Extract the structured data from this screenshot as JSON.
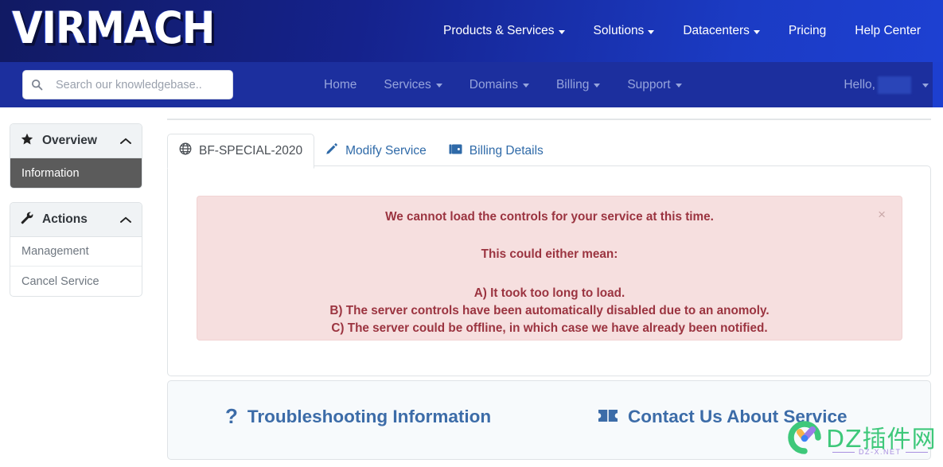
{
  "header": {
    "logo": "VIRMACH",
    "nav": [
      {
        "label": "Products & Services",
        "has_caret": true
      },
      {
        "label": "Solutions",
        "has_caret": true
      },
      {
        "label": "Datacenters",
        "has_caret": true
      },
      {
        "label": "Pricing",
        "has_caret": false
      },
      {
        "label": "Help Center",
        "has_caret": false
      }
    ]
  },
  "subnav": {
    "search": {
      "placeholder": "Search our knowledgebase..",
      "value": "",
      "icon": "search-icon"
    },
    "items": [
      {
        "label": "Home",
        "has_caret": false
      },
      {
        "label": "Services",
        "has_caret": true
      },
      {
        "label": "Domains",
        "has_caret": true
      },
      {
        "label": "Billing",
        "has_caret": true
      },
      {
        "label": "Support",
        "has_caret": true
      }
    ],
    "account": {
      "greeting": "Hello,",
      "username_redacted": true
    }
  },
  "sidebar": {
    "panels": [
      {
        "title": "Overview",
        "icon": "star-icon",
        "collapse_icon": "chevron-up-icon",
        "items": [
          {
            "label": "Information",
            "active": true
          }
        ]
      },
      {
        "title": "Actions",
        "icon": "wrench-icon",
        "collapse_icon": "chevron-up-icon",
        "items": [
          {
            "label": "Management",
            "active": false
          },
          {
            "label": "Cancel Service",
            "active": false
          }
        ]
      }
    ]
  },
  "tabs": [
    {
      "label": "BF-SPECIAL-2020",
      "icon": "globe-icon",
      "active": true
    },
    {
      "label": "Modify Service",
      "icon": "pencil-icon",
      "active": false
    },
    {
      "label": "Billing Details",
      "icon": "wallet-icon",
      "active": false
    }
  ],
  "alert": {
    "close_label": "×",
    "line1": "We cannot load the controls for your service at this time.",
    "line2": "This could either mean:",
    "line3": "A) It took too long to load.",
    "line4": "B) The server controls have been automatically disabled due to an anomoly.",
    "line5": "C) The server could be offline, in which case we have already been notified.",
    "text_color": "#9b3440",
    "bg_color": "#f6dfdf"
  },
  "footer": {
    "links": [
      {
        "label": "Troubleshooting Information",
        "icon": "question-mark-icon"
      },
      {
        "label": "Contact Us About Service",
        "icon": "ticket-icon"
      }
    ]
  },
  "watermark": {
    "text": "DZ插件网",
    "subtitle": "DZ-X.NET",
    "logo_icon": "dz-check-logo-icon"
  },
  "colors": {
    "header_gradient_start": "#111a63",
    "header_gradient_end": "#1d40d2",
    "subnav_bg": "#1c2f9e",
    "link_blue": "#2f6aa8",
    "footer_link_blue": "#3c6ca8",
    "active_item_bg": "#5b5b5b",
    "alert_bg": "#f6dfdf",
    "alert_text": "#9b3440"
  }
}
